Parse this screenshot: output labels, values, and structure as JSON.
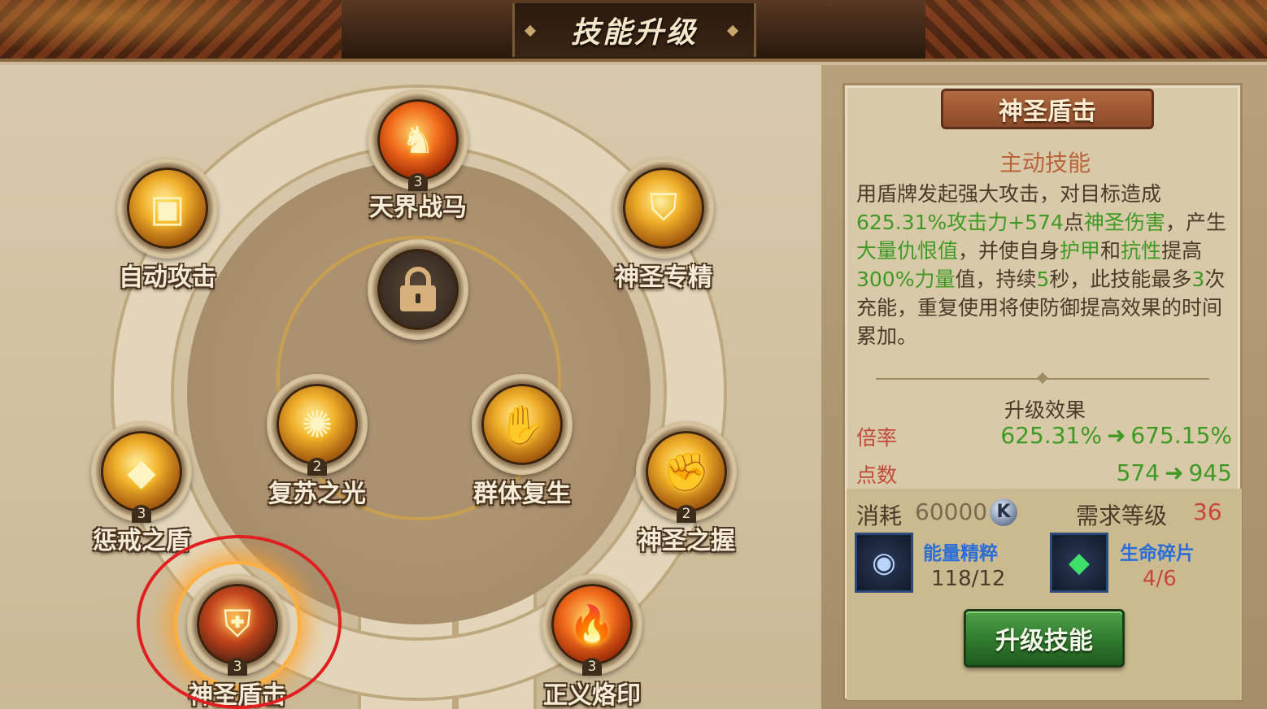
{
  "header": {
    "title": "技能升级"
  },
  "skills": {
    "tianjie": {
      "label": "天界战马",
      "level": "3",
      "icon": "horse-icon"
    },
    "zidong": {
      "label": "自动攻击",
      "level": "",
      "icon": "golden-cubes-icon"
    },
    "zhuanjing": {
      "label": "神圣专精",
      "level": "",
      "icon": "holy-shield-icon"
    },
    "locked": {
      "label": "",
      "icon": "lock-icon"
    },
    "fusu": {
      "label": "复苏之光",
      "level": "2",
      "icon": "light-burst-icon"
    },
    "qunti": {
      "label": "群体复生",
      "level": "",
      "icon": "golden-hand-icon"
    },
    "chengjie": {
      "label": "惩戒之盾",
      "level": "3",
      "icon": "gem-shield-icon"
    },
    "zhiwo": {
      "label": "神圣之握",
      "level": "2",
      "icon": "fist-icon"
    },
    "dunji": {
      "label": "神圣盾击",
      "level": "3",
      "icon": "shield-bash-icon"
    },
    "laoyin": {
      "label": "正义烙印",
      "level": "3",
      "icon": "flame-brand-icon"
    }
  },
  "detail": {
    "name": "神圣盾击",
    "type": "主动技能",
    "desc": {
      "p1": "用盾牌发起强大攻击，对目标造成",
      "g1": "625.31%攻击力+574",
      "p2": "点",
      "g2": "神圣伤害",
      "p3": "，产生",
      "g3": "大量仇恨值",
      "p4": "，并使自身",
      "g4": "护甲",
      "p5": "和",
      "g5": "抗性",
      "p6": "提高",
      "g6": "300%力量",
      "p7": "值，持续",
      "g7": "5",
      "p8": "秒，此技能最多",
      "g8": "3",
      "p9": "次充能，重复使用将使防御提高效果的时间累加。"
    },
    "upgrade_title": "升级效果",
    "rate": {
      "label": "倍率",
      "from": "625.31%",
      "to": "675.15%"
    },
    "points": {
      "label": "点数",
      "from": "574",
      "to": "945"
    },
    "cost": {
      "label": "消耗",
      "value": "60000",
      "coin_letter": "K"
    },
    "requirement": {
      "label": "需求等级",
      "value": "36"
    },
    "materials": [
      {
        "name": "能量精粹",
        "count": "118/12",
        "icon": "energy-orb-icon",
        "count_color": "#4a3b2a"
      },
      {
        "name": "生命碎片",
        "count": "4/6",
        "icon": "green-shard-icon",
        "count_color": "#c8463a"
      }
    ],
    "button": "升级技能"
  },
  "colors": {
    "highlight": "#3f9a24",
    "warning": "#c8463a",
    "accent_red": "#e02020"
  }
}
